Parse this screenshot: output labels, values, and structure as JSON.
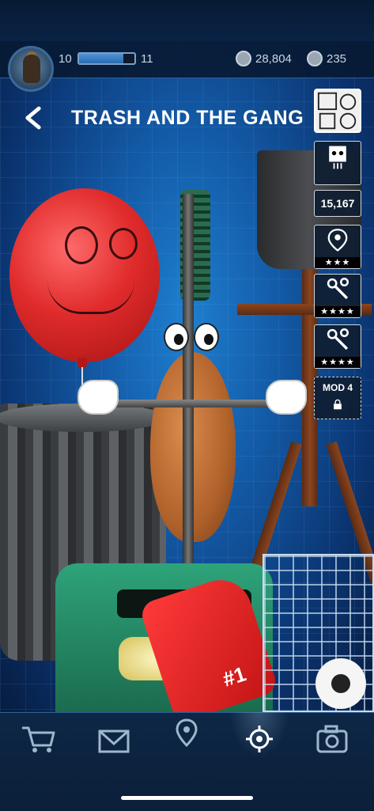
{
  "header": {
    "level_current": "10",
    "level_next": "11",
    "xp_progress": 0.8,
    "currency_coins": "28,804",
    "currency_gems": "235"
  },
  "page": {
    "title": "TRASH AND THE GANG",
    "back_icon": "chevron-left-icon"
  },
  "side_panel": {
    "gallery_icon": "character-gallery-icon",
    "bot_icon": "bot-icon",
    "score": "15,167",
    "location_icon": "location-pin-icon",
    "location_stars": "★★★",
    "mod1_icon": "wrench-icon",
    "mod1_stars": "★★★★",
    "mod2_icon": "wrench-icon",
    "mod2_stars": "★★★★",
    "mod4_label": "MOD 4",
    "mod4_icon": "lock-icon"
  },
  "scene": {
    "foam_finger_text": "#1"
  },
  "bottom_nav": {
    "items": [
      {
        "icon": "shopping-cart-icon"
      },
      {
        "icon": "mail-icon"
      },
      {
        "icon": "map-pin-icon"
      },
      {
        "icon": "workshop-gear-icon",
        "active": true
      },
      {
        "icon": "camera-icon"
      }
    ]
  },
  "colors": {
    "accent": "#2f5f94",
    "xp_fill": "#3f83c6",
    "balloon": "#e02b2b",
    "foam_finger": "#e02424"
  }
}
